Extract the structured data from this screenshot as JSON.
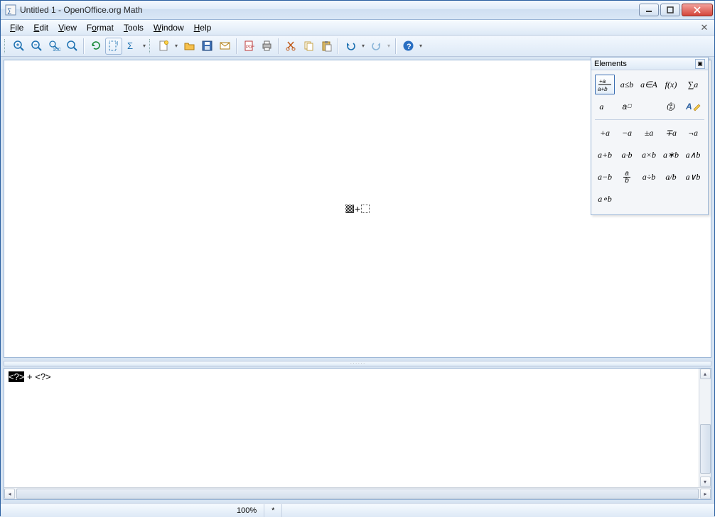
{
  "title": "Untitled 1 - OpenOffice.org Math",
  "menu": {
    "file": "File",
    "edit": "Edit",
    "view": "View",
    "format": "Format",
    "tools": "Tools",
    "window": "Window",
    "help": "Help"
  },
  "toolbar": {
    "zoom_in": "Zoom In",
    "zoom_out": "Zoom Out",
    "zoom_100": "100%",
    "zoom_all": "Show All",
    "refresh": "Refresh",
    "auto_refresh": "Auto Refresh",
    "catalog": "Formula Cursor",
    "new": "New",
    "open": "Open",
    "save": "Save",
    "mail": "Document as E-mail",
    "pdf": "Export as PDF",
    "print": "Print",
    "cut": "Cut",
    "copy": "Copy",
    "paste": "Paste",
    "undo": "Undo",
    "redo": "Redo",
    "help": "Help"
  },
  "elements": {
    "title": "Elements",
    "cats": {
      "unary_binary": "+a⁄a+b",
      "relations": "a≤b",
      "set": "a∈A",
      "functions": "f(x)",
      "operators": "∑a",
      "attributes": "a⃗",
      "brackets": "a☐",
      "formats": "(a b)",
      "others": "A✎"
    },
    "rows": [
      [
        "+a",
        "−a",
        "±a",
        "∓a",
        "¬a"
      ],
      [
        "a+b",
        "a·b",
        "a×b",
        "a∗b",
        "a∧b"
      ],
      [
        "a−b",
        "a/b",
        "a÷b",
        "a/b",
        "a∨b"
      ],
      [
        "a∘b",
        "",
        "",
        "",
        ""
      ]
    ],
    "frac_over": "a",
    "frac_under": "b"
  },
  "commands": {
    "text": "<?> + <?>",
    "highlight": "<?>",
    "rest": " + <?>"
  },
  "preview": {
    "plus": "+"
  },
  "status": {
    "zoom": "100%",
    "modified": "*"
  }
}
